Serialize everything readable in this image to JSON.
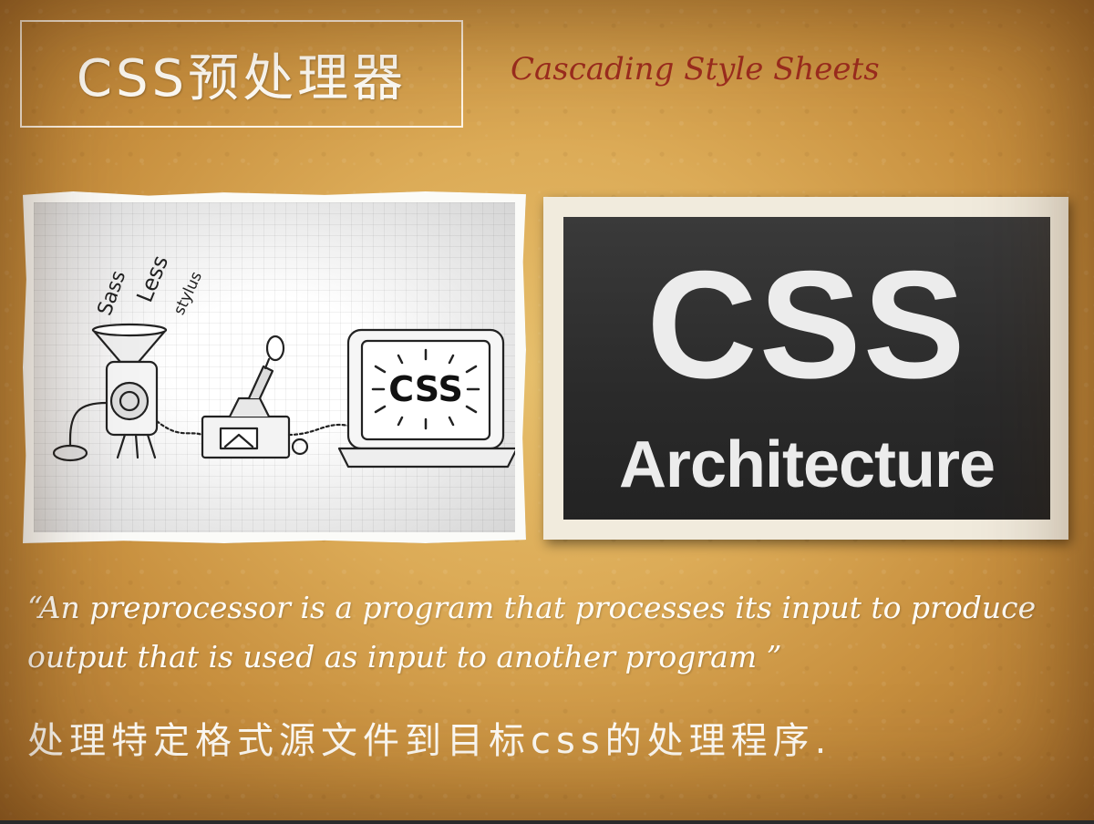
{
  "slide": {
    "title": "CSS预处理器",
    "subtitle": "Cascading Style Sheets",
    "quote": "“An preprocessor is a program that processes its input to produce output that is used as input to another program ”",
    "description": "处理特定格式源文件到目标css的处理程序."
  },
  "sketch": {
    "inputs": [
      "Sass",
      "Less",
      "stylus"
    ],
    "output": "CSS"
  },
  "architecture_image": {
    "big": "CSS",
    "small": "Architecture"
  }
}
